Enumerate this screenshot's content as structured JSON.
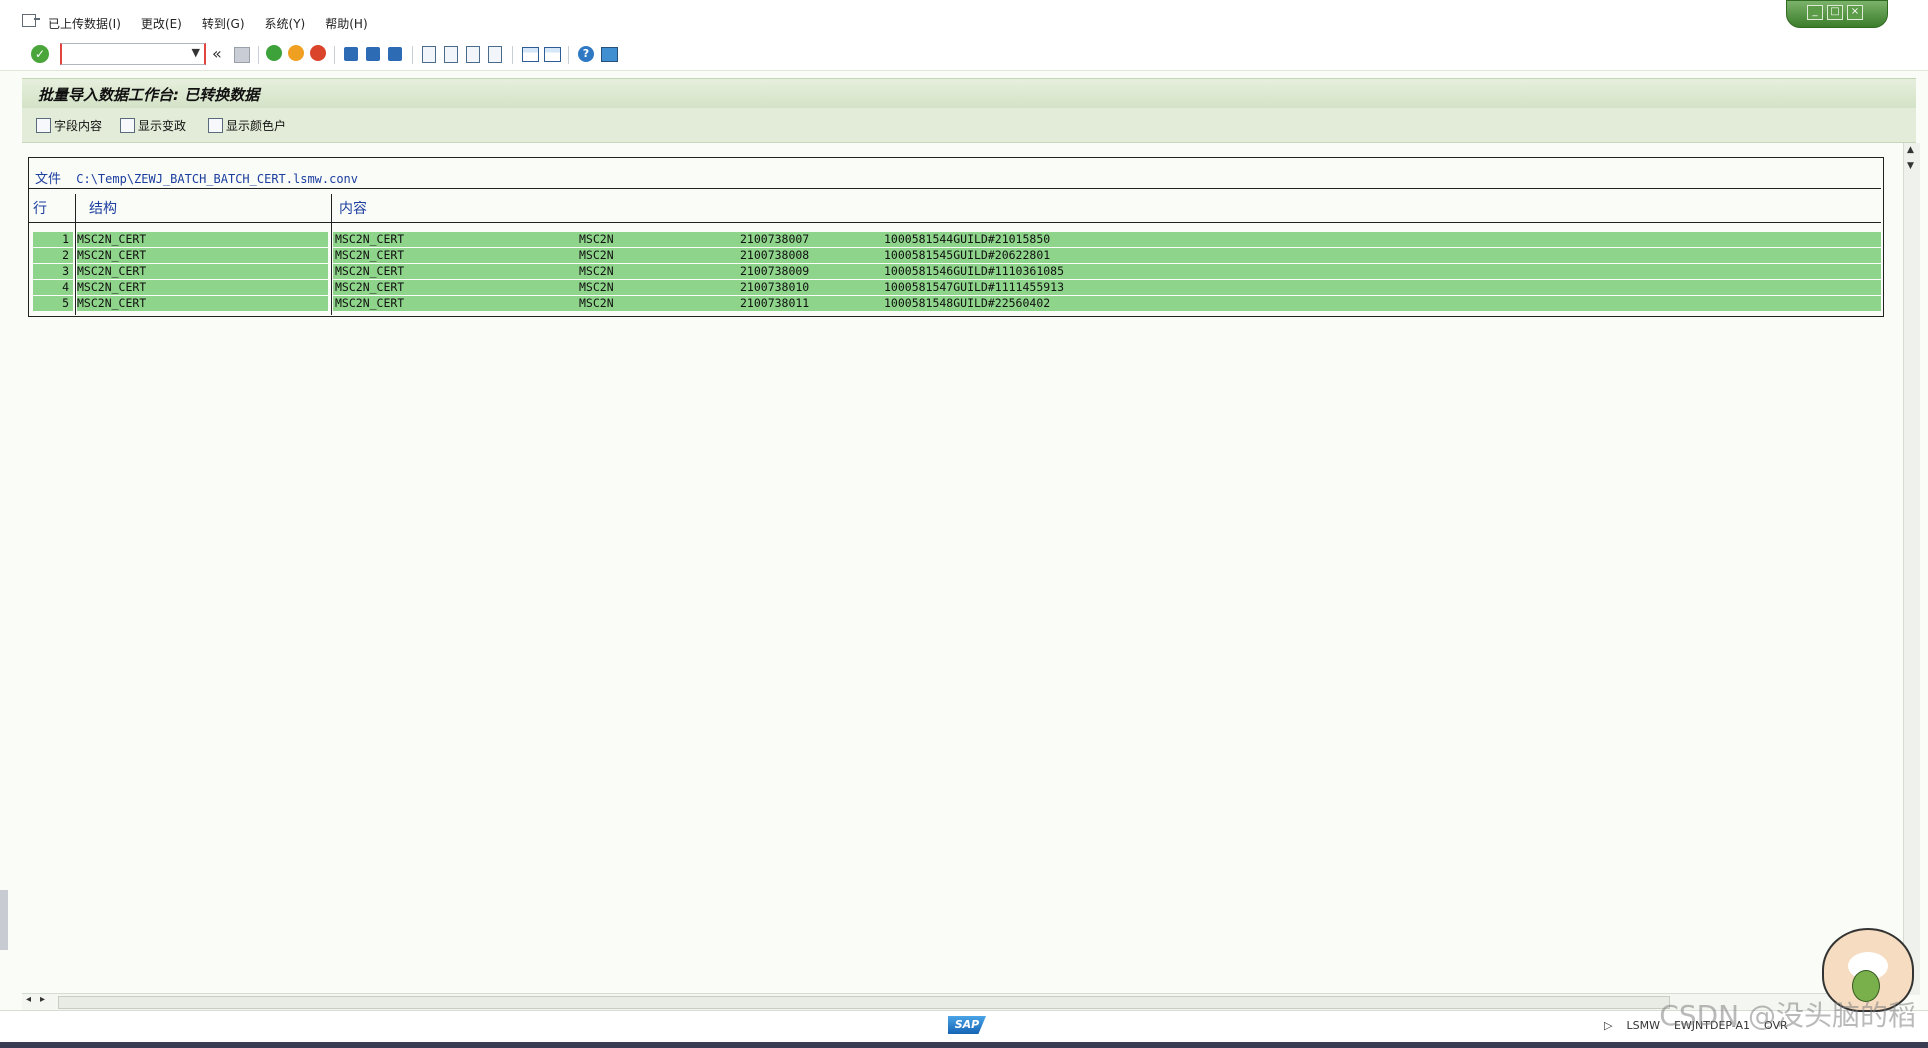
{
  "menu": {
    "items": [
      "已上传数据(I)",
      "更改(E)",
      "转到(G)",
      "系统(Y)",
      "帮助(H)"
    ]
  },
  "window_controls": {
    "minimize": "_",
    "restore": "□",
    "close": "×"
  },
  "toolbar": {
    "command_value": "",
    "ok_icon": "checkmark-icon",
    "collapse_label": "«",
    "help_label": "?"
  },
  "title": "批量导入数据工作台: 已转换数据",
  "app_toolbar": {
    "field_content": "字段内容",
    "show_changes": "显示变政",
    "show_colors": "显示颜色户"
  },
  "file": {
    "label": "文件",
    "path": "C:\\Temp\\ZEWJ_BATCH_BATCH_CERT.lsmw.conv"
  },
  "table": {
    "headers": {
      "row": "行",
      "structure": "结构",
      "content": "内容"
    },
    "rows": [
      {
        "num": "1",
        "structure": "MSC2N_CERT",
        "c1": "MSC2N_CERT",
        "c2": "MSC2N",
        "c3": "2100738007",
        "c4": "1000581544GUILD#21015850"
      },
      {
        "num": "2",
        "structure": "MSC2N_CERT",
        "c1": "MSC2N_CERT",
        "c2": "MSC2N",
        "c3": "2100738008",
        "c4": "1000581545GUILD#20622801"
      },
      {
        "num": "3",
        "structure": "MSC2N_CERT",
        "c1": "MSC2N_CERT",
        "c2": "MSC2N",
        "c3": "2100738009",
        "c4": "1000581546GUILD#1110361085"
      },
      {
        "num": "4",
        "structure": "MSC2N_CERT",
        "c1": "MSC2N_CERT",
        "c2": "MSC2N",
        "c3": "2100738010",
        "c4": "1000581547GUILD#1111455913"
      },
      {
        "num": "5",
        "structure": "MSC2N_CERT",
        "c1": "MSC2N_CERT",
        "c2": "MSC2N",
        "c3": "2100738011",
        "c4": "1000581548GUILD#22560402"
      }
    ]
  },
  "status": {
    "logo": "SAP",
    "transaction": "LSMW",
    "server": "EWJNTDEP-A1",
    "mode": "OVR"
  },
  "watermark": "CSDN @没头脑的稻",
  "colors": {
    "row_highlight": "#8ed48a",
    "title_bg": "#d3e2c6",
    "header_text": "#1c3ea0"
  }
}
